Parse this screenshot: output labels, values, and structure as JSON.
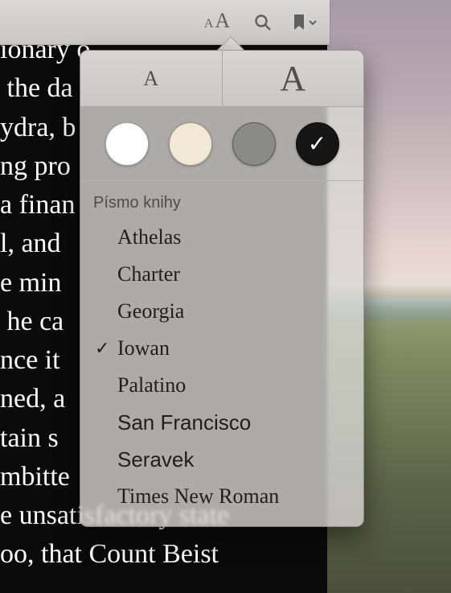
{
  "reader_text": "ionary o\n the da\nydra, b\nng pro\na finan\nl, and\ne min\n he ca\nnce it\nned, a\ntain s\nmbitte\ne unsatisfactory state\noo, that Count Beist",
  "toolbar": {
    "appearance_small": "A",
    "appearance_big": "A"
  },
  "popover": {
    "size_small": "A",
    "size_big": "A",
    "themes": [
      {
        "name": "white",
        "selected": false
      },
      {
        "name": "sepia",
        "selected": false
      },
      {
        "name": "gray",
        "selected": false
      },
      {
        "name": "black",
        "selected": true
      }
    ],
    "font_header": "Písmo knihy",
    "fonts": [
      {
        "name": "Athelas",
        "class": "f-athelas",
        "selected": false
      },
      {
        "name": "Charter",
        "class": "f-charter",
        "selected": false
      },
      {
        "name": "Georgia",
        "class": "f-georgia",
        "selected": false
      },
      {
        "name": "Iowan",
        "class": "f-iowan",
        "selected": true
      },
      {
        "name": "Palatino",
        "class": "f-palatino",
        "selected": false
      },
      {
        "name": "San Francisco",
        "class": "f-sanfrancisco",
        "selected": false
      },
      {
        "name": "Seravek",
        "class": "f-seravek",
        "selected": false
      },
      {
        "name": "Times New Roman",
        "class": "f-times",
        "selected": false
      }
    ],
    "checkmark": "✓"
  }
}
